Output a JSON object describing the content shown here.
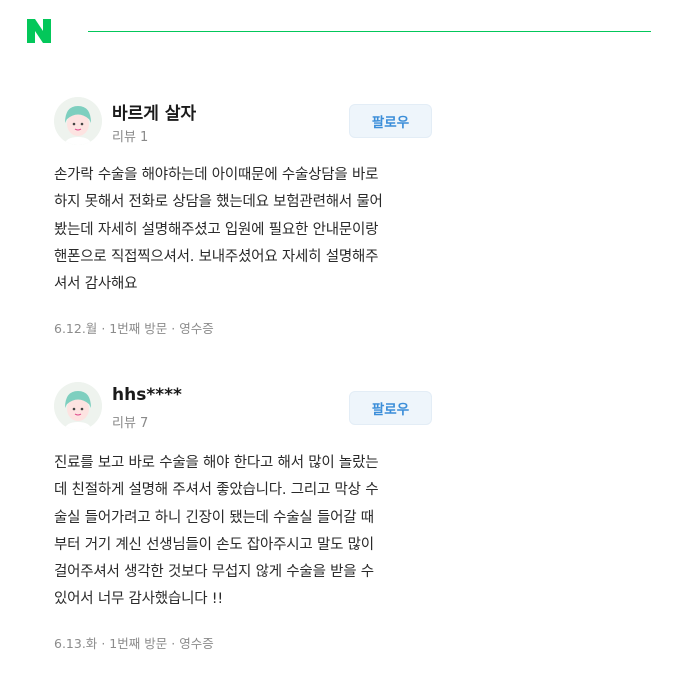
{
  "header": {
    "logo_text": "N",
    "brand_color": "#03c75a"
  },
  "reviews": [
    {
      "author": "바르게 살자",
      "review_count": "리뷰 1",
      "follow_label": "팔로우",
      "text": "손가락 수술을 해야하는데 아이때문에 수술상담을 바로\n하지 못해서 전화로 상담을 했는데요 보험관련해서 물어\n봤는데 자세히 설명해주셨고 입원에 필요한 안내문이랑\n핸폰으로 직접찍으셔서. 보내주셨어요 자세히 설명해주\n셔서 감사해요",
      "date": "6.12.월",
      "visit": "1번째 방문",
      "receipt": "영수증"
    },
    {
      "author": "hhs****",
      "review_count": "리뷰 7",
      "follow_label": "팔로우",
      "text": "진료를 보고 바로 수술을 해야 한다고 해서 많이 놀랐는\n데 친절하게 설명해 주셔서 좋았습니다. 그리고 막상 수\n술실 들어가려고 하니 긴장이 됐는데 수술실 들어갈 때\n부터 거기 계신 선생님들이 손도 잡아주시고 말도 많이\n걸어주셔서 생각한 것보다 무섭지 않게 수술을 받을 수\n있어서 너무 감사했습니다 !!",
      "date": "6.13.화",
      "visit": "1번째 방문",
      "receipt": "영수증"
    }
  ]
}
